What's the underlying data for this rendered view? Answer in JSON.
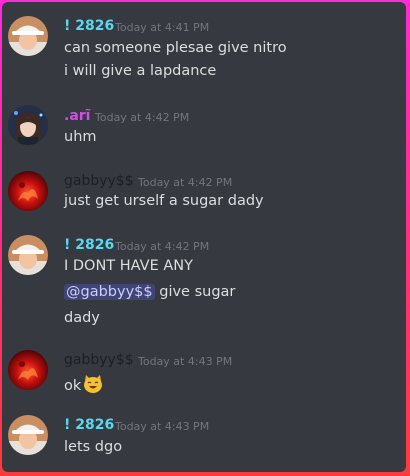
{
  "colors": {
    "background": "#36393f",
    "frame_gradient": [
      "#ff2bd6",
      "#ff3a3a"
    ],
    "username_2826": "#5ad8f0",
    "username_ari": "#d64ce8",
    "username_gabbyy": "#1e1f22",
    "timestamp": "#72767d",
    "message_text": "#dcddde",
    "mention_text": "#c9cdfb"
  },
  "messages": [
    {
      "author": "! 2826",
      "time": "Today at 4:41 PM",
      "lines": [
        "can someone plesae give nitro",
        "i will give a lapdance"
      ],
      "avatar_icon": "white-bucket-hat-avatar-icon"
    },
    {
      "author": ".arĩ",
      "time": "Today at 4:42 PM",
      "lines": [
        "uhm"
      ],
      "avatar_icon": "anime-girl-avatar-icon"
    },
    {
      "author": "gabbyy$$",
      "time": "Today at 4:42 PM",
      "lines": [
        "just get urself a sugar dady"
      ],
      "avatar_icon": "red-fire-avatar-icon"
    },
    {
      "author": "! 2826",
      "time": "Today at 4:42 PM",
      "lines": [
        "I DONT HAVE ANY",
        "give sugar",
        "dady"
      ],
      "mention": "@gabbyy$$",
      "avatar_icon": "white-bucket-hat-avatar-icon"
    },
    {
      "author": "gabbyy$$",
      "time": "Today at 4:43 PM",
      "lines": [
        "ok"
      ],
      "emoji_icon": "smiling-cat-emoji-icon",
      "avatar_icon": "red-fire-avatar-icon"
    },
    {
      "author": "! 2826",
      "time": "Today at 4:43 PM",
      "lines": [
        "lets dgo"
      ],
      "avatar_icon": "white-bucket-hat-avatar-icon"
    }
  ]
}
